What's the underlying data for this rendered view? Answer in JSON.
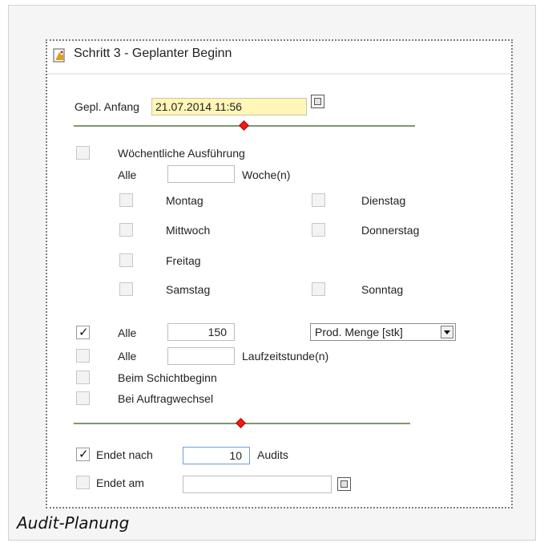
{
  "panel": {
    "title": "Schritt 3 - Geplanter Beginn"
  },
  "planned_start": {
    "label": "Gepl. Anfang",
    "value": "21.07.2014 11:56"
  },
  "weekly": {
    "label": "Wöchentliche Ausführung",
    "checked": false,
    "every_label": "Alle",
    "interval_value": "",
    "unit_label": "Woche(n)",
    "days": [
      {
        "label": "Montag",
        "checked": false
      },
      {
        "label": "Dienstag",
        "checked": false
      },
      {
        "label": "Mittwoch",
        "checked": false
      },
      {
        "label": "Donnerstag",
        "checked": false
      },
      {
        "label": "Freitag",
        "checked": false
      },
      {
        "label": "Samstag",
        "checked": false
      },
      {
        "label": "Sonntag",
        "checked": false
      }
    ]
  },
  "quantity": {
    "checked": true,
    "every_label": "Alle",
    "value": "150",
    "select_value": "Prod. Menge [stk]"
  },
  "runtime": {
    "checked": false,
    "every_label": "Alle",
    "value": "",
    "unit_label": "Laufzeitstunde(n)"
  },
  "shift_start": {
    "label": "Beim Schichtbeginn",
    "checked": false
  },
  "order_change": {
    "label": "Bei Auftragwechsel",
    "checked": false
  },
  "ends_after": {
    "label": "Endet nach",
    "checked": true,
    "value": "10",
    "unit_label": "Audits"
  },
  "ends_on": {
    "label": "Endet am",
    "checked": false,
    "value": ""
  },
  "caption": "Audit-Planung",
  "colors": {
    "separator": "#7f9670",
    "diamond": "#f01818",
    "date_field_bg": "#fff6b8",
    "active_field_border": "#6f9fd8"
  }
}
